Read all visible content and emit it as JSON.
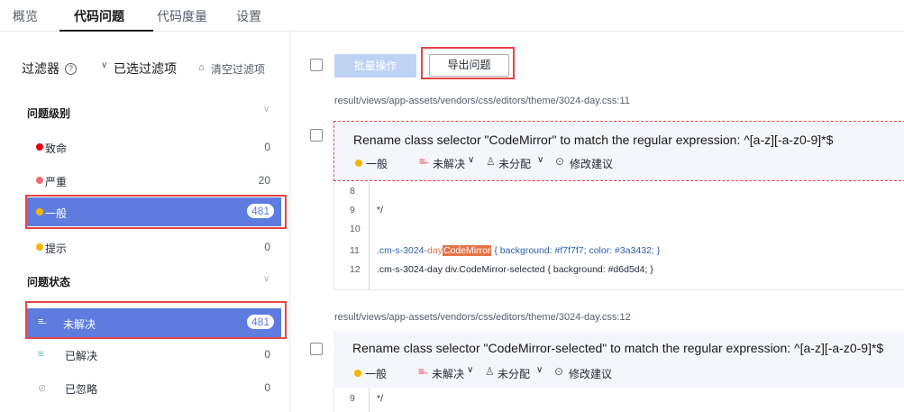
{
  "tabs": [
    {
      "label": "概览"
    },
    {
      "label": "代码问题"
    },
    {
      "label": "代码度量"
    },
    {
      "label": "设置"
    }
  ],
  "sidebar": {
    "filter_label": "过滤器",
    "selected_filters_label": "已选过滤项",
    "clear_filters_label": "清空过滤项",
    "level_section": "问题级别",
    "levels": [
      {
        "label": "致命",
        "count": "0",
        "color": "#e60012"
      },
      {
        "label": "严重",
        "count": "20",
        "color": "#f56c6c"
      },
      {
        "label": "一般",
        "count": "481",
        "color": "#f7b500"
      },
      {
        "label": "提示",
        "count": "0",
        "color": "#f7b500"
      }
    ],
    "status_section": "问题状态",
    "statuses": [
      {
        "label": "未解决",
        "count": "481",
        "icon": "unresolved-icon"
      },
      {
        "label": "已解决",
        "count": "0",
        "icon": "resolved-icon"
      },
      {
        "label": "已忽略",
        "count": "0",
        "icon": "ignored-icon"
      }
    ]
  },
  "toolbar": {
    "batch_label": "批量操作",
    "export_label": "导出问题"
  },
  "issues": [
    {
      "path": "result/views/app-assets/vendors/css/editors/theme/3024-day.css:11",
      "title": "Rename class selector \"CodeMirror\" to match the regular expression: ^[a-z][-a-z0-9]*$",
      "severity": "一般",
      "status": "未解决",
      "assignee": "未分配",
      "suggest": "修改建议",
      "lines": [
        {
          "n": "8",
          "text": ""
        },
        {
          "n": "9",
          "text": "*/"
        },
        {
          "n": "10",
          "text": ""
        },
        {
          "n": "11",
          "pre": ".cm-s-3024-",
          "mid": "day",
          "hl": "CodeMirror",
          "post": " { background: #f7f7f7; color: #3a3432; }"
        },
        {
          "n": "12",
          "text": ".cm-s-3024-day div.CodeMirror-selected { background: #d6d5d4; }"
        }
      ]
    },
    {
      "path": "result/views/app-assets/vendors/css/editors/theme/3024-day.css:12",
      "title": "Rename class selector \"CodeMirror-selected\" to match the regular expression: ^[a-z][-a-z0-9]*$",
      "severity": "一般",
      "status": "未解决",
      "assignee": "未分配",
      "suggest": "修改建议",
      "lines": [
        {
          "n": "9",
          "text": "*/"
        }
      ]
    }
  ]
}
